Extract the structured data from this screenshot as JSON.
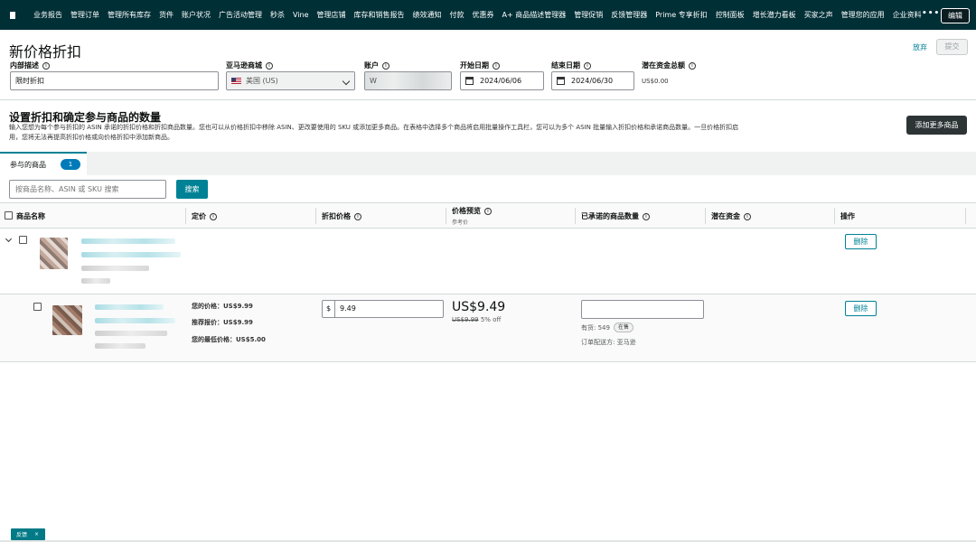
{
  "nav": {
    "items": [
      "业务报告",
      "管理订单",
      "管理所有库存",
      "货件",
      "账户状况",
      "广告活动管理",
      "秒杀",
      "Vine",
      "管理店铺",
      "库存和销售报告",
      "绩效通知",
      "付款",
      "优惠券",
      "A+ 商品描述管理器",
      "管理促销",
      "反馈管理器",
      "Prime 专享折扣",
      "控制面板",
      "增长潜力看板",
      "买家之声",
      "管理您的应用",
      "企业资料"
    ],
    "more": "•••",
    "edit": "编辑"
  },
  "header": {
    "title": "新价格折扣",
    "abandon": "放弃",
    "submit": "提交"
  },
  "form": {
    "internal_desc_label": "内部描述",
    "internal_desc_value": "限时折扣",
    "marketplace_label": "亚马逊商城",
    "marketplace_value": "美国 (US)",
    "account_label": "账户",
    "account_value": "W",
    "start_label": "开始日期",
    "start_value": "2024/06/06",
    "end_label": "结束日期",
    "end_value": "2024/06/30",
    "budget_label": "潜在资金总额",
    "budget_value": "US$0.00"
  },
  "section": {
    "title": "设置折扣和确定参与商品的数量",
    "desc": "输入您想为每个参与折扣的 ASIN 承诺的折扣价格和折扣商品数量。您也可以从价格折扣中移除 ASIN、更改要使用的 SKU 或添加更多商品。在表格中选择多个商品将启用批量操作工具栏，您可以为多个 ASIN 批量输入折扣价格和承诺商品数量。一旦价格折扣启用，您将无法再提高折扣价格或向价格折扣中添加新商品。",
    "add_more": "添加更多商品"
  },
  "tab": {
    "label": "参与的商品",
    "count": "1"
  },
  "search": {
    "placeholder": "按商品名称、ASIN 或 SKU 搜索",
    "button": "搜索"
  },
  "table": {
    "headers": {
      "name": "商品名称",
      "price": "定价",
      "discount": "折扣价格",
      "preview": "价格预览",
      "preview_sub": "参考价",
      "qty": "已承诺的商品数量",
      "funding": "潜在资金",
      "action": "操作"
    },
    "parent": {
      "delete": "删除"
    },
    "child": {
      "your_price": "您的价格：US$9.99",
      "list_price": "推荐报价：US$9.99",
      "min_price": "您的最低价格：US$5.00",
      "currency": "$",
      "discount_value": "9.49",
      "preview_price": "US$9.49",
      "was_price": "US$9.99",
      "off": "5% off",
      "stock_label": "有货: 549",
      "stock_badge": "在售",
      "fulfillment": "订单配送方: 亚马逊",
      "delete": "删除"
    }
  },
  "feedback": {
    "label": "反馈",
    "close": "×"
  },
  "colors": {
    "nav_bg": "#002f36",
    "accent": "#008296",
    "badge": "#007ab8"
  }
}
